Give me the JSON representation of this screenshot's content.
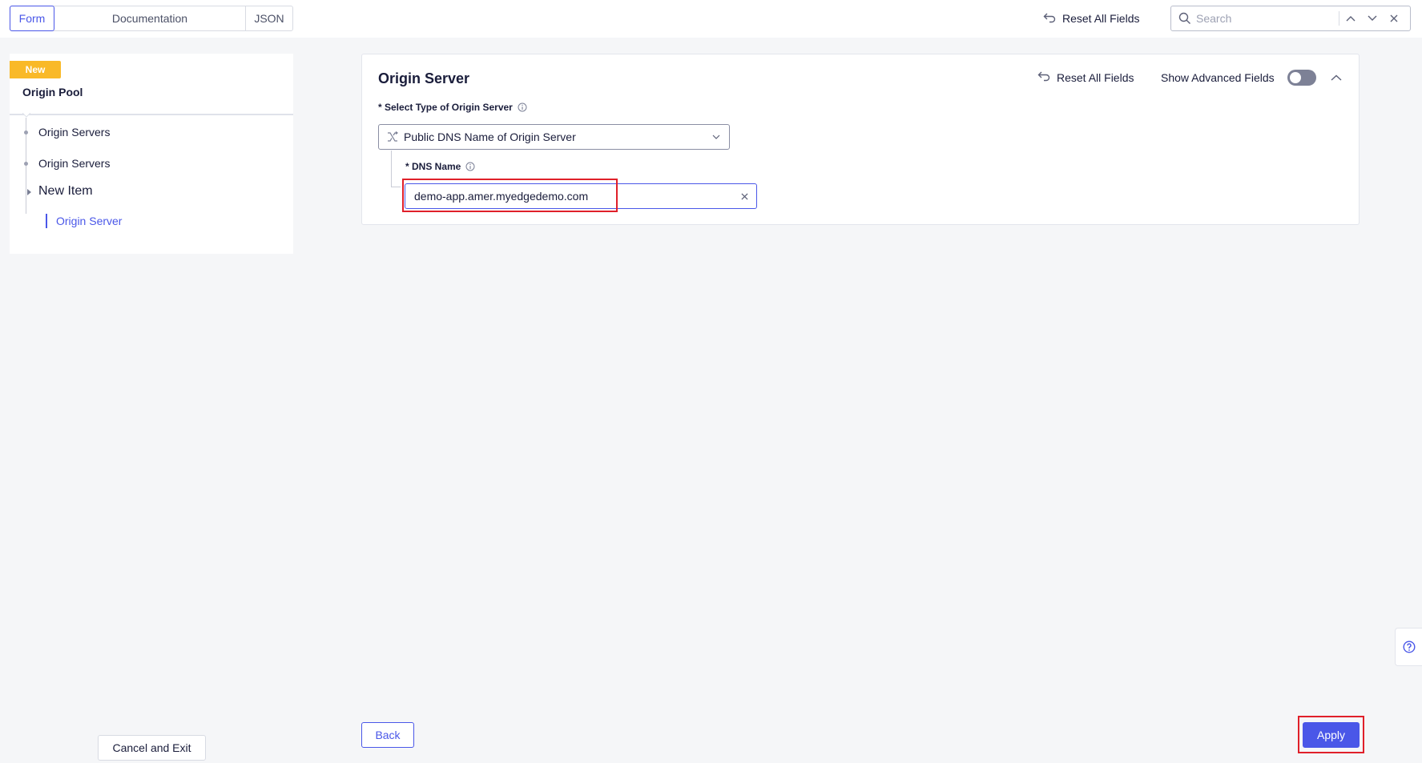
{
  "tabs": {
    "form": "Form",
    "documentation": "Documentation",
    "json": "JSON"
  },
  "topbar": {
    "reset_label": "Reset All Fields",
    "search_placeholder": "Search"
  },
  "sidebar": {
    "badge": "New",
    "title": "Origin Pool",
    "items": [
      {
        "label": "Origin Servers"
      },
      {
        "label": "Origin Servers"
      },
      {
        "label": "New Item"
      }
    ],
    "sub_item": "Origin Server"
  },
  "card": {
    "title": "Origin Server",
    "reset_label": "Reset All Fields",
    "advanced_label": "Show Advanced Fields",
    "advanced_enabled": false,
    "type_field": {
      "label": "* Select Type of Origin Server",
      "value": "Public DNS Name of Origin Server"
    },
    "dns_field": {
      "label": "* DNS Name",
      "value": "demo-app.amer.myedgedemo.com"
    }
  },
  "footer": {
    "cancel_label": "Cancel and Exit",
    "back_label": "Back",
    "apply_label": "Apply"
  },
  "colors": {
    "accent": "#4a57e8",
    "badge": "#f9b928",
    "highlight": "#e0202a",
    "background": "#f5f6f8"
  }
}
